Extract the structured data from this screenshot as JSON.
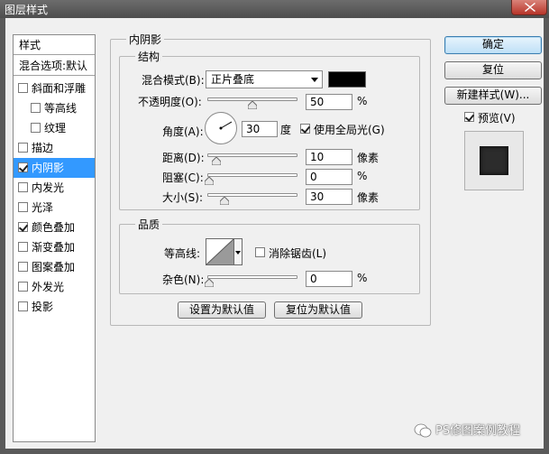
{
  "window": {
    "title": "图层样式"
  },
  "style_list": {
    "header": "样式",
    "blend_options": "混合选项:默认",
    "items": [
      {
        "label": "斜面和浮雕",
        "checked": false,
        "indent": false,
        "selected": false
      },
      {
        "label": "等高线",
        "checked": false,
        "indent": true,
        "selected": false
      },
      {
        "label": "纹理",
        "checked": false,
        "indent": true,
        "selected": false
      },
      {
        "label": "描边",
        "checked": false,
        "indent": false,
        "selected": false
      },
      {
        "label": "内阴影",
        "checked": true,
        "indent": false,
        "selected": true
      },
      {
        "label": "内发光",
        "checked": false,
        "indent": false,
        "selected": false
      },
      {
        "label": "光泽",
        "checked": false,
        "indent": false,
        "selected": false
      },
      {
        "label": "颜色叠加",
        "checked": true,
        "indent": false,
        "selected": false
      },
      {
        "label": "渐变叠加",
        "checked": false,
        "indent": false,
        "selected": false
      },
      {
        "label": "图案叠加",
        "checked": false,
        "indent": false,
        "selected": false
      },
      {
        "label": "外发光",
        "checked": false,
        "indent": false,
        "selected": false
      },
      {
        "label": "投影",
        "checked": false,
        "indent": false,
        "selected": false
      }
    ]
  },
  "panel": {
    "title": "内阴影",
    "structure": {
      "title": "结构",
      "blend_mode_label": "混合模式(B):",
      "blend_mode_value": "正片叠底",
      "shadow_color": "#000000",
      "opacity_label": "不透明度(O):",
      "opacity_value": "50",
      "opacity_unit": "%",
      "angle_label": "角度(A):",
      "angle_value": "30",
      "angle_unit": "度",
      "global_light_label": "使用全局光(G)",
      "global_light_checked": true,
      "distance_label": "距离(D):",
      "distance_value": "10",
      "distance_unit": "像素",
      "choke_label": "阻塞(C):",
      "choke_value": "0",
      "choke_unit": "%",
      "size_label": "大小(S):",
      "size_value": "30",
      "size_unit": "像素"
    },
    "quality": {
      "title": "品质",
      "contour_label": "等高线:",
      "antialias_label": "消除锯齿(L)",
      "antialias_checked": false,
      "noise_label": "杂色(N):",
      "noise_value": "0",
      "noise_unit": "%"
    },
    "make_default_label": "设置为默认值",
    "reset_default_label": "复位为默认值"
  },
  "buttons": {
    "ok": "确定",
    "reset": "复位",
    "new_style": "新建样式(W)...",
    "preview_label": "预览(V)",
    "preview_checked": true
  },
  "watermark": {
    "text": "PS修图案例教程"
  }
}
